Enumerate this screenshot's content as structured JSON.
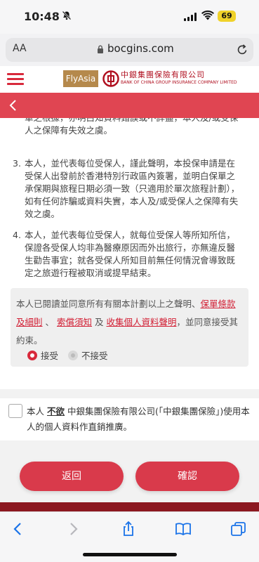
{
  "status_bar": {
    "time": "10:48",
    "battery": "69"
  },
  "browser": {
    "text_size_label": "AA",
    "url": "bocgins.com"
  },
  "site_header": {
    "flyasia_label": "FlyAsia",
    "company_name_cn": "中銀集團保險有限公司",
    "company_name_en": "BANK OF CHINA GROUP INSURANCE COMPANY LIMITED"
  },
  "terms": {
    "intro_text": "單之根據，亦明白知資料錯誤或不詳盡，本人及/或受保人之保障有失效之虞。",
    "items": [
      {
        "num": "3.",
        "text": "本人，並代表每位受保人，謹此聲明，本投保申請是在受保人出發前於香港特別行政區內簽署，並明白保單之承保期與旅程日期必須一致（只適用於單次旅程計劃），如有任何詐騙或資料失實，本人及/或受保人之保障有失效之虞。"
      },
      {
        "num": "4.",
        "text": "本人，並代表每位受保人，就每位受保人等所知所信，保證各受保人均非為醫療原因而外出旅行，亦無違反醫生勸告事宜；就各受保人所知目前無任何情況會導致既定之旅遊行程被取消或提早結束。"
      }
    ],
    "agreement": {
      "prefix": "本人已閱讀並同意所有有關本計劃以上之聲明、",
      "link_policy": "保單條款及細則",
      "sep1": "、",
      "link_claims": "索償須知",
      "and": "及",
      "link_privacy": "收集個人資料聲明",
      "suffix": "，並同意接受其約束。"
    },
    "options": {
      "accept": "接受",
      "reject": "不接受",
      "selected": "accept"
    }
  },
  "marketing_optout": {
    "prefix": "本人",
    "emphasis": "不欲",
    "suffix": "中銀集團保險有限公司(「中銀集團保險」)使用本人的個人資料作直銷推廣。"
  },
  "buttons": {
    "back": "返回",
    "confirm": "確認"
  },
  "colors": {
    "brand_red": "#d8293b",
    "button_red": "#d93a4b",
    "gold": "#b5894c"
  }
}
